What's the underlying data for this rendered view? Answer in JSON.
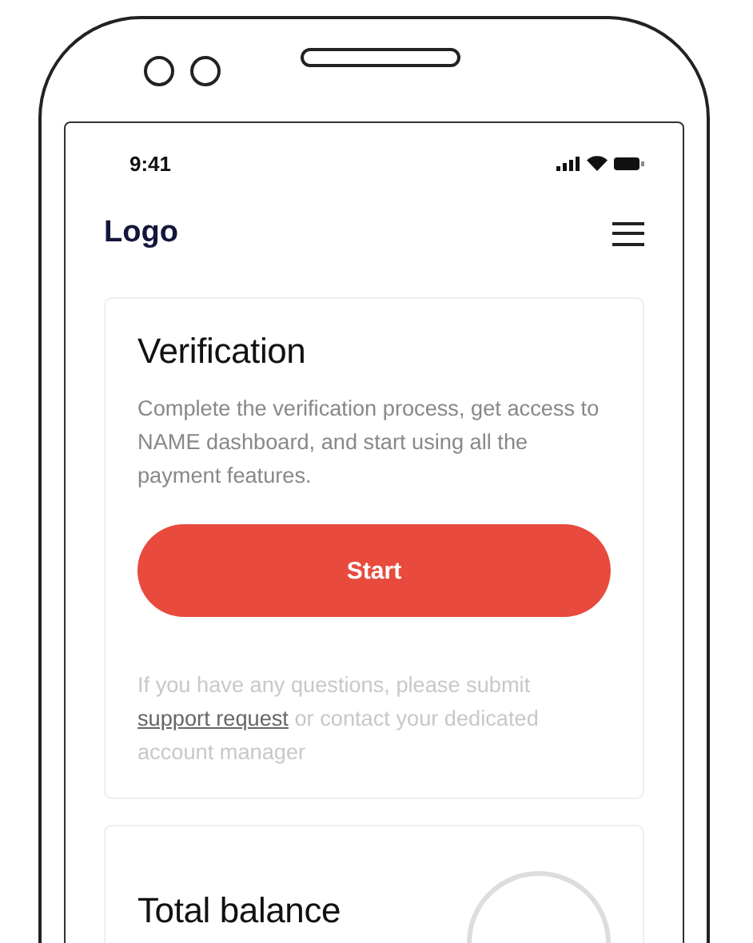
{
  "status_bar": {
    "time": "9:41"
  },
  "header": {
    "logo": "Logo"
  },
  "verification_card": {
    "title": "Verification",
    "description": "Complete the verification process, get access to NAME dashboard, and start using all the payment features.",
    "button": "Start",
    "help_before": "If you have any questions, please submit",
    "help_link": "support request",
    "help_after": "or contact your dedicated account manager"
  },
  "balance_card": {
    "title": "Total balance"
  }
}
